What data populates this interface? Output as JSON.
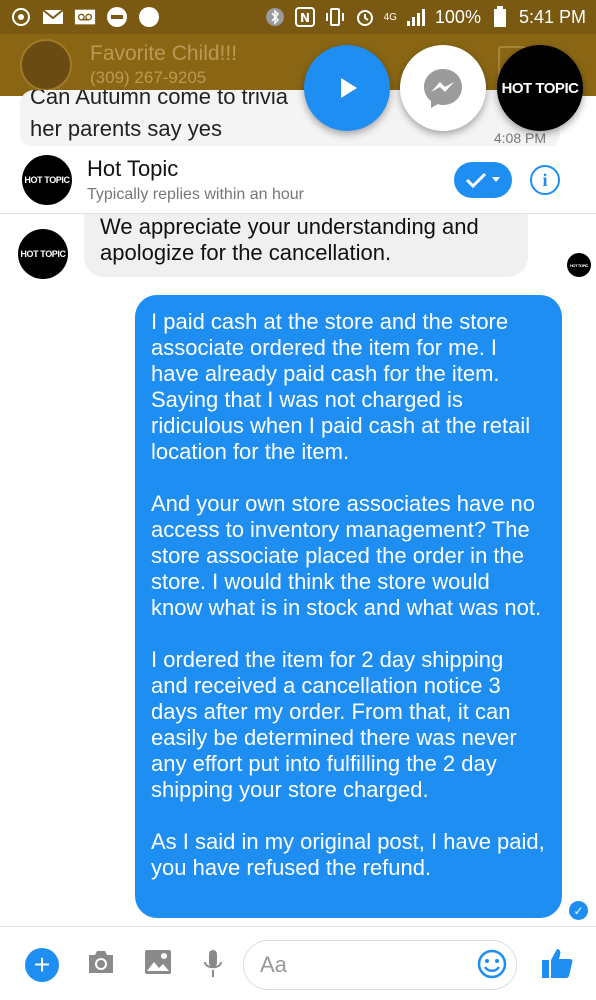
{
  "status_bar": {
    "time": "5:41 PM",
    "battery": "100%",
    "network": "4G",
    "left_icons": [
      "chrome-icon",
      "mail-icon",
      "voicemail-icon",
      "do-not-disturb-icon",
      "circle-icon"
    ],
    "right_icons": [
      "bluetooth-icon",
      "nfc-icon",
      "vibrate-icon",
      "alarm-icon",
      "signal-icon",
      "battery-icon"
    ]
  },
  "background_chat": {
    "contact_name": "Favorite Child!!!",
    "contact_phone": "(309) 267-9205",
    "cut_text": "Can Autumn come to trivia",
    "message": "her parents say yes",
    "time": "4:08 PM"
  },
  "chat_heads": {
    "hottopic_label": "HOT TOPIC"
  },
  "conversation": {
    "name": "Hot Topic",
    "subtitle": "Typically replies within an hour",
    "logo_text": "HOT TOPIC"
  },
  "messages": {
    "incoming": "We appreciate your understanding and apologize for the cancellation.",
    "outgoing": [
      "I paid cash at the store and the store associate ordered the item for me. I have already paid cash for the item. Saying that I was not charged is ridiculous when I paid cash at the retail location for the item.",
      "And your own store associates have no access to inventory management? The store associate placed the order in the store. I would think the store would know what is in stock and what was not.",
      "I ordered the item for 2 day shipping and received a cancellation notice 3 days after my order. From that, it can easily be determined there was never any effort put into fulfilling the 2 day shipping your store charged.",
      "As I said in my original post, I have paid, you have refused the refund."
    ]
  },
  "composer": {
    "placeholder": "Aa"
  },
  "colors": {
    "accent": "#1e8ef2",
    "incoming_bubble": "#f1f0f0",
    "dim_overlay": "#7a5a12"
  }
}
